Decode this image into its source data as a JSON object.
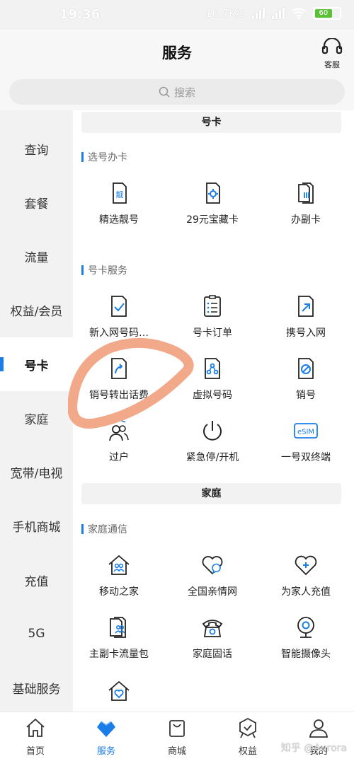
{
  "status": {
    "time": "19:36",
    "net_speed": "10.7K/s",
    "battery": "60"
  },
  "topbar": {
    "title": "服务",
    "cs_label": "客服",
    "cs_icon": "headset-icon"
  },
  "search": {
    "placeholder": "搜索",
    "icon": "search-icon"
  },
  "sidebar": {
    "items": [
      {
        "label": "查询"
      },
      {
        "label": "套餐"
      },
      {
        "label": "流量"
      },
      {
        "label": "权益/会员"
      },
      {
        "label": "号卡",
        "active": true
      },
      {
        "label": "家庭"
      },
      {
        "label": "宽带/电视"
      },
      {
        "label": "手机商城"
      },
      {
        "label": "充值"
      },
      {
        "label": "5G"
      },
      {
        "label": "基础服务"
      }
    ]
  },
  "main": {
    "section1": {
      "title": "号卡",
      "group1": {
        "title": "选号办卡",
        "items": [
          {
            "label": "精选靓号",
            "icon": "pretty-number-card-icon"
          },
          {
            "label": "29元宝藏卡",
            "icon": "treasure-card-icon"
          },
          {
            "label": "办副卡",
            "icon": "sim-card-icon"
          }
        ]
      },
      "group2": {
        "title": "号卡服务",
        "items": [
          {
            "label": "新入网号码…",
            "icon": "new-number-check-icon"
          },
          {
            "label": "号卡订单",
            "icon": "order-list-icon"
          },
          {
            "label": "携号入网",
            "icon": "port-in-icon"
          },
          {
            "label": "销号转出话费",
            "icon": "balance-transfer-icon"
          },
          {
            "label": "虚拟号码",
            "icon": "virtual-number-icon"
          },
          {
            "label": "销号",
            "icon": "cancel-number-icon"
          },
          {
            "label": "过户",
            "icon": "transfer-owner-icon"
          },
          {
            "label": "紧急停/开机",
            "icon": "power-icon"
          },
          {
            "label": "一号双终端",
            "icon": "esim-icon"
          }
        ]
      }
    },
    "section2": {
      "title": "家庭",
      "group1": {
        "title": "家庭通信",
        "items": [
          {
            "label": "移动之家",
            "icon": "family-home-icon"
          },
          {
            "label": "全国亲情网",
            "icon": "heart-chat-icon"
          },
          {
            "label": "为家人充值",
            "icon": "heart-plus-icon"
          },
          {
            "label": "主副卡流量包",
            "icon": "shared-data-card-icon"
          },
          {
            "label": "家庭固话",
            "icon": "landline-phone-icon"
          },
          {
            "label": "智能摄像头",
            "icon": "camera-icon"
          },
          {
            "label": "",
            "icon": "home-heart-icon"
          }
        ]
      }
    }
  },
  "tabbar": {
    "items": [
      {
        "label": "首页",
        "icon": "home-icon"
      },
      {
        "label": "服务",
        "icon": "heart-service-icon",
        "active": true
      },
      {
        "label": "商城",
        "icon": "shopping-bag-icon"
      },
      {
        "label": "权益",
        "icon": "benefits-badge-icon"
      },
      {
        "label": "我的",
        "icon": "profile-icon"
      }
    ]
  },
  "watermark": "知乎 @Aurora",
  "colors": {
    "accent": "#1a7de8",
    "annotation": "#f2a98a"
  }
}
